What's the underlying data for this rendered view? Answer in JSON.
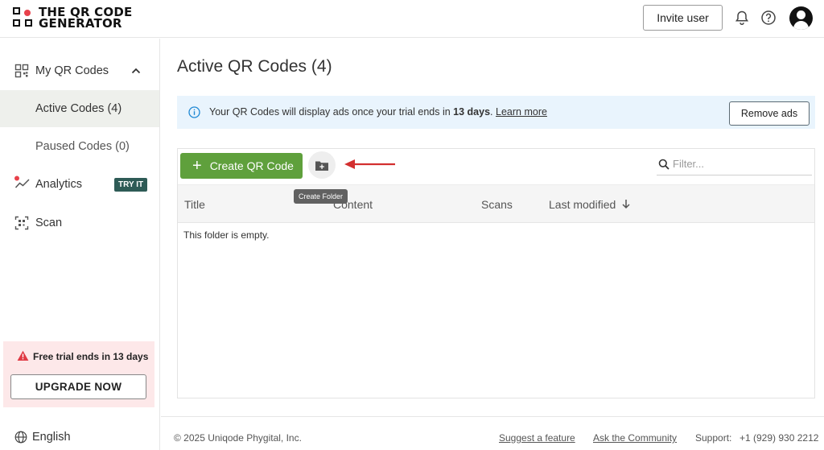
{
  "header": {
    "logo_line1": "THE QR CODE",
    "logo_line2": "GENERATOR",
    "invite_label": "Invite user",
    "brand_color": "#e8414b"
  },
  "sidebar": {
    "items": [
      {
        "label": "My QR Codes",
        "icon": "qr-grid-icon"
      },
      {
        "label": "Active Codes (4)"
      },
      {
        "label": "Paused Codes (0)"
      },
      {
        "label": "Analytics",
        "icon": "analytics-icon",
        "badge": "TRY IT"
      },
      {
        "label": "Scan",
        "icon": "scan-icon"
      }
    ],
    "trial_text": "Free trial ends in 13 days",
    "upgrade_label": "UPGRADE NOW",
    "language": "English",
    "active_bg": "#eef0ec"
  },
  "main": {
    "title": "Active QR Codes (4)",
    "banner": {
      "prefix": "Your QR Codes will display ads once your trial ends in ",
      "days": "13 days",
      "suffix": ".",
      "link": "Learn more",
      "button": "Remove ads",
      "bg": "#e9f4fd"
    },
    "create_label": "Create QR Code",
    "create_color": "#5fa03c",
    "folder_tooltip": "Create Folder",
    "filter_placeholder": "Filter...",
    "columns": [
      "Title",
      "Content",
      "Scans",
      "Last modified"
    ],
    "empty_text": "This folder is empty."
  },
  "footer": {
    "copyright": "© 2025 Uniqode Phygital, Inc.",
    "suggest": "Suggest a feature",
    "community": "Ask the Community",
    "support_label": "Support:",
    "support_phone": "+1 (929) 930 2212"
  }
}
